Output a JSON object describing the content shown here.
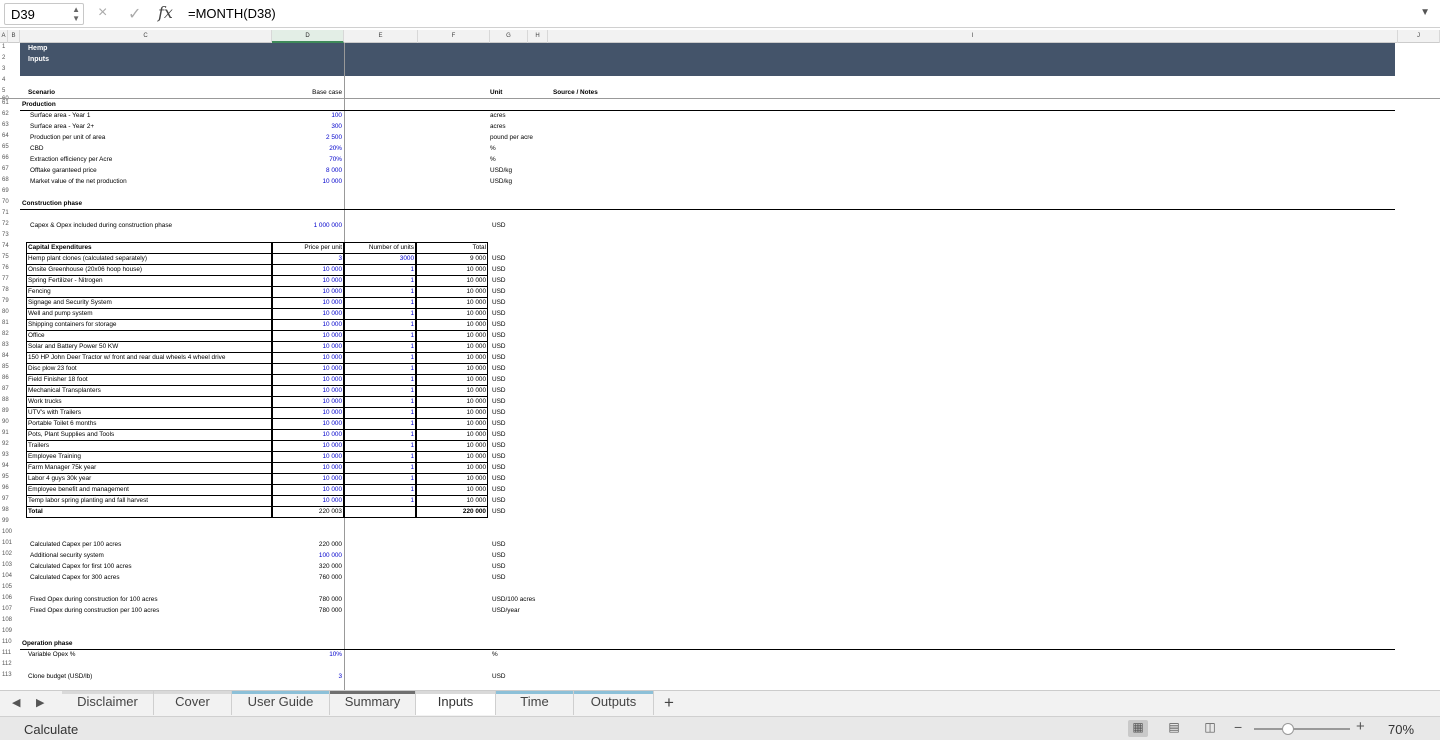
{
  "formula_bar": {
    "cell_ref": "D39",
    "cancel_icon": "×",
    "confirm_icon": "✓",
    "fx": "fx",
    "formula": "=MONTH(D38)"
  },
  "columns": [
    "A",
    "B",
    "C",
    "D",
    "E",
    "F",
    "G",
    "H",
    "I",
    "J"
  ],
  "header_band": {
    "rows": [
      "1",
      "2",
      "3"
    ],
    "title": "Hemp",
    "subtitle": "Inputs"
  },
  "top_rows": [
    {
      "row": "4"
    },
    {
      "row": "5",
      "b": "Scenario",
      "d": "Base case",
      "g": "Unit",
      "h": "Source / Notes"
    },
    {
      "row": "60"
    }
  ],
  "production": {
    "section_row": "61",
    "title": "Production",
    "rows": [
      {
        "row": "62",
        "label": "Surface area - Year 1",
        "value": "100",
        "unit": "acres"
      },
      {
        "row": "63",
        "label": "Surface area - Year 2+",
        "value": "300",
        "unit": "acres"
      },
      {
        "row": "64",
        "label": "Production per unit of area",
        "value": "2 500",
        "unit": "pound per acre"
      },
      {
        "row": "65",
        "label": "CBD",
        "value": "20%",
        "unit": "%"
      },
      {
        "row": "66",
        "label": "Extraction efficiency per Acre",
        "value": "70%",
        "unit": "%"
      },
      {
        "row": "67",
        "label": "Offtake garanteed price",
        "value": "8 000",
        "unit": "USD/kg"
      },
      {
        "row": "68",
        "label": "Market value of the net production",
        "value": "10 000",
        "unit": "USD/kg"
      }
    ],
    "blank_row": "69"
  },
  "construction": {
    "section_row": "70",
    "title": "Construction phase",
    "blank_row": "71",
    "capex_opex_row": {
      "row": "72",
      "label": "Capex & Opex included during construction phase",
      "value": "1 000 000",
      "unit": "USD"
    },
    "blank_row2": "73"
  },
  "capex_table": {
    "header_row": "74",
    "headers": {
      "item": "Capital Expenditures",
      "price": "Price per unit",
      "units": "Number of units",
      "total": "Total"
    },
    "rows": [
      {
        "row": "75",
        "item": "Hemp plant clones (calculated separately)",
        "price": "3",
        "units": "3000",
        "total": "9 000",
        "unit": "USD"
      },
      {
        "row": "76",
        "item": "Onsite Greenhouse (20x06 hoop house)",
        "price": "10 000",
        "units": "1",
        "total": "10 000",
        "unit": "USD"
      },
      {
        "row": "77",
        "item": "Spring Fertilizer - Nitrogen",
        "price": "10 000",
        "units": "1",
        "total": "10 000",
        "unit": "USD"
      },
      {
        "row": "78",
        "item": "Fencing",
        "price": "10 000",
        "units": "1",
        "total": "10 000",
        "unit": "USD"
      },
      {
        "row": "79",
        "item": "Signage and Security System",
        "price": "10 000",
        "units": "1",
        "total": "10 000",
        "unit": "USD"
      },
      {
        "row": "80",
        "item": "Well and pump system",
        "price": "10 000",
        "units": "1",
        "total": "10 000",
        "unit": "USD"
      },
      {
        "row": "81",
        "item": "Shipping containers for storage",
        "price": "10 000",
        "units": "1",
        "total": "10 000",
        "unit": "USD"
      },
      {
        "row": "82",
        "item": "Office",
        "price": "10 000",
        "units": "1",
        "total": "10 000",
        "unit": "USD"
      },
      {
        "row": "83",
        "item": "Solar and Battery Power 50 KW",
        "price": "10 000",
        "units": "1",
        "total": "10 000",
        "unit": "USD"
      },
      {
        "row": "84",
        "item": "150 HP John Deer Tractor w/ front and rear dual wheels 4 wheel drive",
        "price": "10 000",
        "units": "1",
        "total": "10 000",
        "unit": "USD"
      },
      {
        "row": "85",
        "item": "Disc plow 23 foot",
        "price": "10 000",
        "units": "1",
        "total": "10 000",
        "unit": "USD"
      },
      {
        "row": "86",
        "item": "Field Finisher 18 foot",
        "price": "10 000",
        "units": "1",
        "total": "10 000",
        "unit": "USD"
      },
      {
        "row": "87",
        "item": "Mechanical Transplanters",
        "price": "10 000",
        "units": "1",
        "total": "10 000",
        "unit": "USD"
      },
      {
        "row": "88",
        "item": "Work trucks",
        "price": "10 000",
        "units": "1",
        "total": "10 000",
        "unit": "USD"
      },
      {
        "row": "89",
        "item": "UTV's with Trailers",
        "price": "10 000",
        "units": "1",
        "total": "10 000",
        "unit": "USD"
      },
      {
        "row": "90",
        "item": "Portable Toilet 6 months",
        "price": "10 000",
        "units": "1",
        "total": "10 000",
        "unit": "USD"
      },
      {
        "row": "91",
        "item": "Pots, Plant Supplies and Tools",
        "price": "10 000",
        "units": "1",
        "total": "10 000",
        "unit": "USD"
      },
      {
        "row": "92",
        "item": "Trailers",
        "price": "10 000",
        "units": "1",
        "total": "10 000",
        "unit": "USD"
      },
      {
        "row": "93",
        "item": "Employee Training",
        "price": "10 000",
        "units": "1",
        "total": "10 000",
        "unit": "USD"
      },
      {
        "row": "94",
        "item": "Farm Manager 75k year",
        "price": "10 000",
        "units": "1",
        "total": "10 000",
        "unit": "USD"
      },
      {
        "row": "95",
        "item": "Labor 4 guys 30k year",
        "price": "10 000",
        "units": "1",
        "total": "10 000",
        "unit": "USD"
      },
      {
        "row": "96",
        "item": "Employee benefit and management",
        "price": "10 000",
        "units": "1",
        "total": "10 000",
        "unit": "USD"
      },
      {
        "row": "97",
        "item": " Temp labor spring planting and fall harvest",
        "price": "10 000",
        "units": "1",
        "total": "10 000",
        "unit": "USD"
      }
    ],
    "total_row": {
      "row": "98",
      "item": "Total",
      "price": "220 003",
      "total": "220 000",
      "unit": "USD"
    }
  },
  "blank_rows_a": [
    "99",
    "100"
  ],
  "calc_rows": [
    {
      "row": "101",
      "label": "Calculated Capex per 100 acres",
      "value": "220 000",
      "unit": "USD"
    },
    {
      "row": "102",
      "label": "Additional security system",
      "value": "100 000",
      "unit": "USD",
      "blue": true
    },
    {
      "row": "103",
      "label": "Calculated Capex for first 100 acres",
      "value": "320 000",
      "unit": "USD"
    },
    {
      "row": "104",
      "label": "Calculated Capex for 300 acres",
      "value": "760 000",
      "unit": "USD"
    }
  ],
  "blank_row_b": "105",
  "opex_rows": [
    {
      "row": "106",
      "label": "Fixed Opex during construction for 100 acres",
      "value": "780 000",
      "unit": "USD/100 acres"
    },
    {
      "row": "107",
      "label": "Fixed Opex during construction per 100 acres",
      "value": "780 000",
      "unit": "USD/year"
    }
  ],
  "blank_rows_c": [
    "108",
    "109"
  ],
  "operation": {
    "section_row": "110",
    "title": "Operation phase",
    "rows": [
      {
        "row": "111",
        "label": "Variable Opex %",
        "value": "10%",
        "unit": "%"
      },
      {
        "row": "112"
      },
      {
        "row": "113",
        "label": "Clone budget (USD/lb)",
        "value": "3",
        "unit": "USD"
      }
    ]
  },
  "sheet_tabs": [
    {
      "label": "Disclaimer",
      "color": "#d9d9d9",
      "active": false
    },
    {
      "label": "Cover",
      "color": "#d9d9d9",
      "active": false
    },
    {
      "label": "User Guide",
      "color": "#8cc0d8",
      "active": false
    },
    {
      "label": "Summary",
      "color": "#707070",
      "active": false
    },
    {
      "label": "Inputs",
      "color": "#d9d9d9",
      "active": true
    },
    {
      "label": "Time",
      "color": "#8cc0d8",
      "active": false
    },
    {
      "label": "Outputs",
      "color": "#8cc0d8",
      "active": false
    }
  ],
  "status_bar": {
    "status": "Calculate",
    "zoom": "70%",
    "zoom_minus": "−",
    "zoom_plus": "+"
  },
  "colors": {
    "header_band": "#44546a",
    "input_blue": "#0000cc",
    "selected_column": "#3f8a5a"
  }
}
